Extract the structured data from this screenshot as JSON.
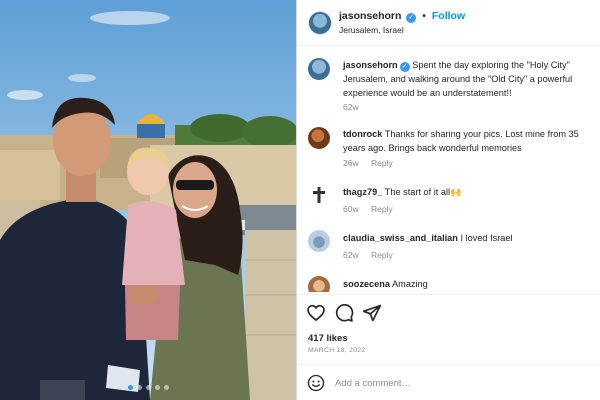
{
  "post": {
    "username": "jasonsehorn",
    "follow_label": "Follow",
    "location": "Jerusalem, Israel",
    "caption_user": "jasonsehorn",
    "caption_text": "Spent the day exploring the \"Holy City\" Jerusalem, and walking around the \"Old City\" a powerful experience would be an understatement!!",
    "caption_age": "62w"
  },
  "comments": [
    {
      "user": "tdonrock",
      "text": "Thanks for sharing your pics. Lost mine from 35 years ago. Brings back wonderful memories",
      "age": "26w",
      "reply_label": "Reply"
    },
    {
      "user": "thagz79_",
      "text": "The start of it all🙌",
      "age": "60w",
      "reply_label": "Reply"
    },
    {
      "user": "claudia_swiss_and_italian",
      "text": "I loved Israel",
      "age": "62w",
      "reply_label": "Reply"
    },
    {
      "user": "soozecena",
      "text": "Amazing",
      "age": "",
      "reply_label": ""
    }
  ],
  "actions": {
    "likes": "417 likes",
    "date": "MARCH 18, 2022",
    "icons": [
      "heart-icon",
      "comment-icon",
      "share-icon"
    ]
  },
  "add_comment": {
    "placeholder": "Add a comment…"
  },
  "carousel": {
    "count": 5,
    "active": 0
  },
  "colors": {
    "accent": "#0095f6",
    "verified": "#3897f0",
    "muted": "#8e8e8e",
    "text": "#262626"
  }
}
